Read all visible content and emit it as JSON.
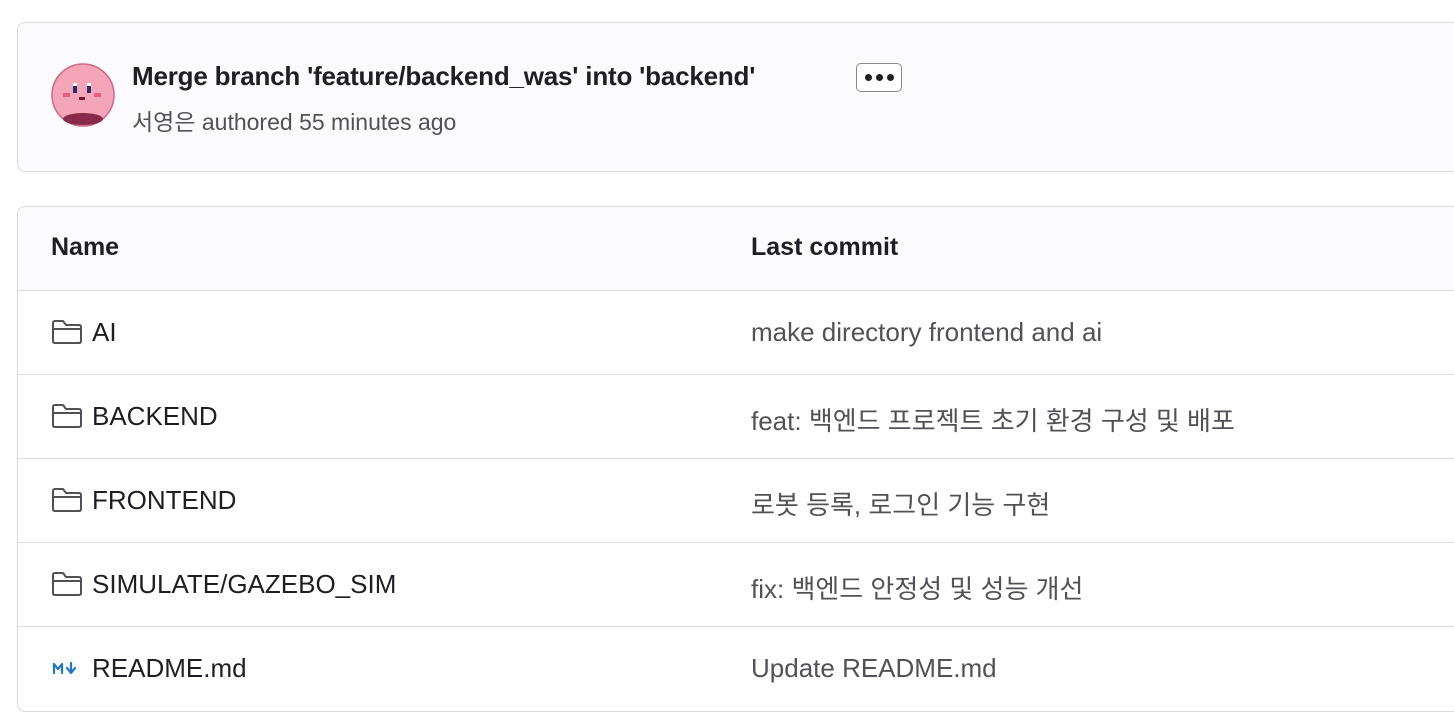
{
  "commit": {
    "title": "Merge branch 'feature/backend_was' into 'backend'",
    "author": "서영은",
    "meta_suffix": " authored 55 minutes ago"
  },
  "table": {
    "headers": {
      "name": "Name",
      "last_commit": "Last commit"
    },
    "rows": [
      {
        "name": "AI",
        "type": "folder",
        "icon": "folder-icon",
        "commit": "make directory frontend and ai"
      },
      {
        "name": "BACKEND",
        "type": "folder",
        "icon": "folder-icon",
        "commit": "feat: 백엔드 프로젝트 초기 환경 구성 및 배포"
      },
      {
        "name": "FRONTEND",
        "type": "folder",
        "icon": "folder-icon",
        "commit": "로봇 등록, 로그인 기능 구현"
      },
      {
        "name": "SIMULATE/GAZEBO_SIM",
        "type": "folder",
        "icon": "folder-icon",
        "commit": "fix: 백엔드 안정성 및 성능 개선"
      },
      {
        "name": "README.md",
        "type": "markdown",
        "icon": "markdown-icon",
        "commit": "Update README.md"
      }
    ]
  },
  "colors": {
    "markdown_icon": "#1f75cb",
    "muted_text": "#535158",
    "border": "#dcdcde"
  }
}
